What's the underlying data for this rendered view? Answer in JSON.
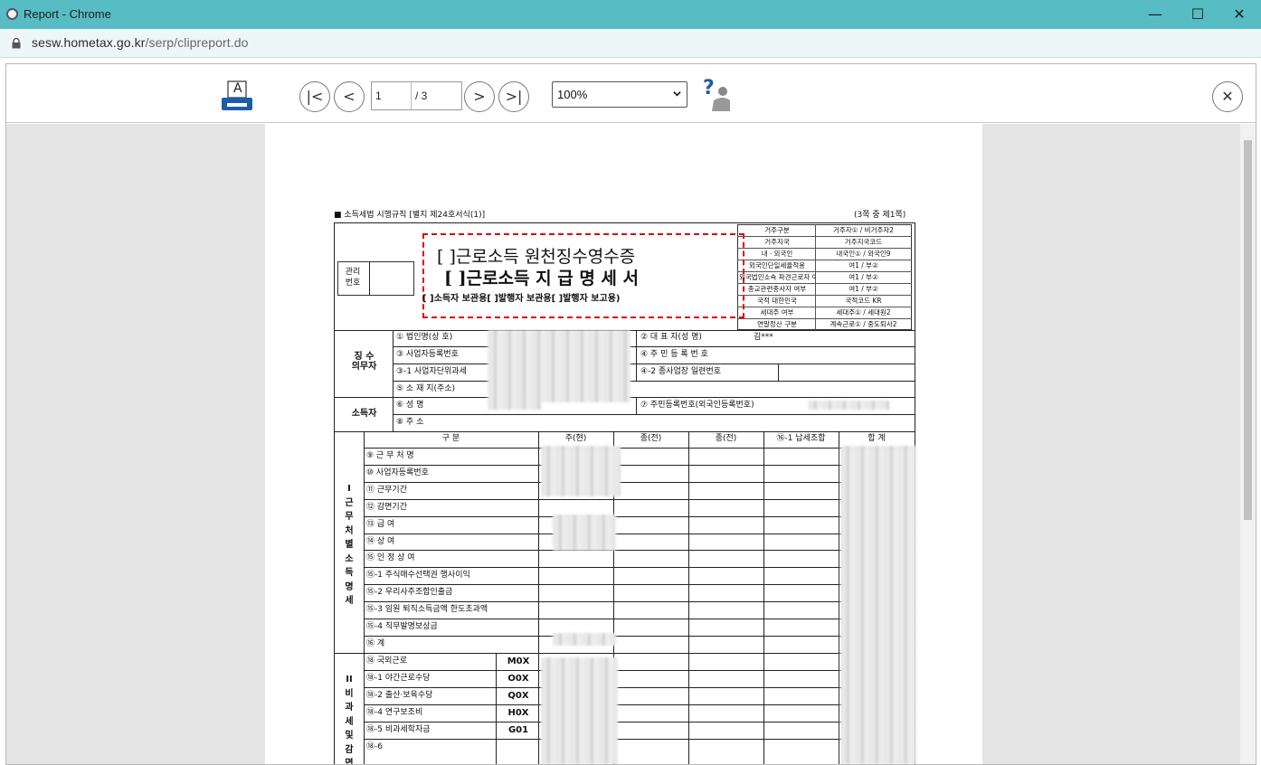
{
  "window": {
    "title": "Report - Chrome",
    "minimize": "—",
    "maximize": "☐",
    "close": "✕"
  },
  "address": {
    "host": "sesw.hometax.go.kr",
    "path": "/serp/clipreport.do"
  },
  "toolbar": {
    "print_icon_letter": "A",
    "first": "|<",
    "prev": "<",
    "next": ">",
    "last": ">|",
    "page_current": "1",
    "page_total": "/ 3",
    "zoom": "100%",
    "help": "?",
    "close": "✕"
  },
  "doc": {
    "rule_caption": "■ 소득세법 시행규칙 [별지 제24호서식(1)]",
    "page_caption": "(3쪽 중 제1쪽)",
    "title_line1": "[ ]근로소득 원천징수영수증",
    "title_line2": "[ ]근로소득 지 급 명 세 서",
    "title_line3": "[     ]소득자 보관용[      ]발행자 보관용[      ]발행자 보고용)",
    "mgmt_label": "관리\n번호",
    "info": [
      [
        "거주구분",
        "거주자① / 비거주자2"
      ],
      [
        "거주지국",
        "거주지국코드"
      ],
      [
        "내ㆍ외국인",
        "내국인① / 외국인9"
      ],
      [
        "외국인단일세율적용",
        "여1 / 부②"
      ],
      [
        "외국법인소속 파견근로자 여부",
        "여1 / 부②"
      ],
      [
        "종교관련종사자 여부",
        "여1 / 부②"
      ],
      [
        "국적 대한민국",
        "국적코드 KR"
      ],
      [
        "세대주 여부",
        "세대주① / 세대원2"
      ],
      [
        "연말정산 구분",
        "계속근로① / 중도퇴사2"
      ]
    ],
    "payer_label": "징 수\n의무자",
    "payer": {
      "f1": "① 법인명(상 호)",
      "f2": "② 대 표 자(성 명)",
      "f2_value": "김***",
      "f3": "③ 사업자등록번호",
      "f4": "④ 주 민 등 록 번 호",
      "f5": "③-1 사업자단위과세",
      "f6": "④-2 종사업장 일련번호",
      "f7": "⑤ 소 재 지(주소)"
    },
    "earner_label": "소득자",
    "earner": {
      "f1": "⑥ 성        명",
      "f2": "⑦ 주민등록번호(외국인등록번호)",
      "f3": "⑧ 주        소"
    },
    "section1_label": "I\n근\n무\n처\n별\n소\n득\n명\n세",
    "columns": [
      "구  분",
      "주(현)",
      "종(전)",
      "종(전)",
      "⑯-1 납세조합",
      "합  계"
    ],
    "rows1": [
      "⑨ 근  무  처  명",
      "⑩ 사업자등록번호",
      "⑪ 근무기간",
      "⑫ 감면기간",
      "⑬ 급           여",
      "⑭ 상           여",
      "⑮ 인  정  상  여",
      "⑮-1 주식매수선택권 행사이익",
      "⑮-2 우리사주조합인출금",
      "⑮-3 임원 퇴직소득금액 한도초과액",
      "⑮-4 직무발명보상금",
      "⑯ 계"
    ],
    "section2_label": "II\n비\n과\n세\n및\n감\n면",
    "rows2": [
      [
        "⑱ 국외근로",
        "M0X"
      ],
      [
        "⑱-1 야간근로수당",
        "O0X"
      ],
      [
        "⑱-2 출산·보육수당",
        "Q0X"
      ],
      [
        "⑱-4 연구보조비",
        "H0X"
      ],
      [
        "⑱-5 비과세학자금",
        "G01"
      ],
      [
        "⑱-6",
        ""
      ]
    ]
  },
  "colors": {
    "titlebar": "#57bcc4",
    "highlight_box": "#e00000",
    "canvas": "#e4e4e4"
  }
}
